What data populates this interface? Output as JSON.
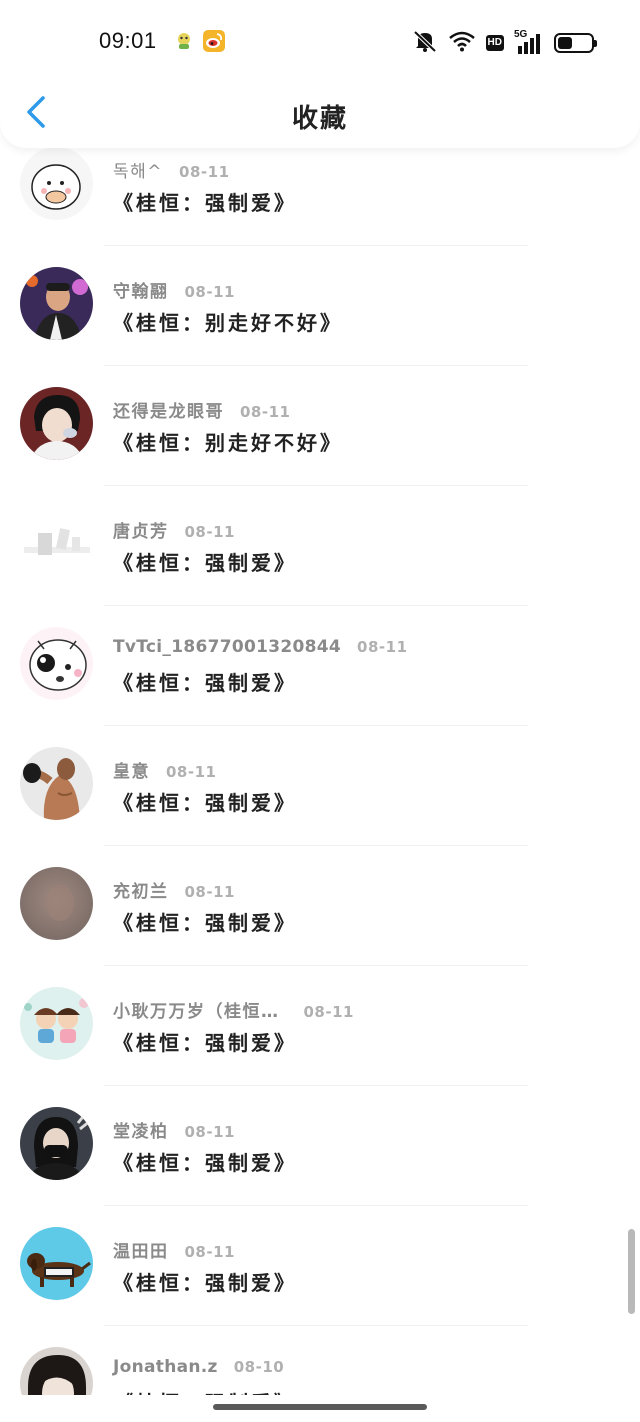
{
  "status_bar": {
    "time": "09:01",
    "icons": [
      "app-notification-icon",
      "weibo-icon",
      "mute-icon",
      "wifi-icon",
      "hd-icon",
      "5g-signal-icon",
      "battery-icon"
    ],
    "hd_label": "HD",
    "network_label": "5G",
    "battery_level": 0.45
  },
  "header": {
    "title": "收藏",
    "back_icon": "chevron-left-icon"
  },
  "favorites": [
    {
      "user": "독해^",
      "date": "08-11",
      "song": "《桂恒：强制爱》"
    },
    {
      "user": "守翰翮",
      "date": "08-11",
      "song": "《桂恒：别走好不好》"
    },
    {
      "user": "还得是龙眼哥",
      "date": "08-11",
      "song": "《桂恒：别走好不好》"
    },
    {
      "user": "唐贞芳",
      "date": "08-11",
      "song": "《桂恒：强制爱》"
    },
    {
      "user": "TvTci_18677001320844",
      "date": "08-11",
      "song": "《桂恒：强制爱》"
    },
    {
      "user": "皇意",
      "date": "08-11",
      "song": "《桂恒：强制爱》"
    },
    {
      "user": "充初兰",
      "date": "08-11",
      "song": "《桂恒：强制爱》"
    },
    {
      "user": "小耿万万岁（桂恒…",
      "date": "08-11",
      "song": "《桂恒：强制爱》"
    },
    {
      "user": "堂凌柏",
      "date": "08-11",
      "song": "《桂恒：强制爱》"
    },
    {
      "user": "温田田",
      "date": "08-11",
      "song": "《桂恒：强制爱》"
    },
    {
      "user": "Jonathan.z",
      "date": "08-10",
      "song": "《桂恒：强制爱》"
    }
  ],
  "colors": {
    "accent": "#2f9ae8",
    "username": "#8a8a8a",
    "date": "#b0b0b0",
    "title": "#222222"
  }
}
